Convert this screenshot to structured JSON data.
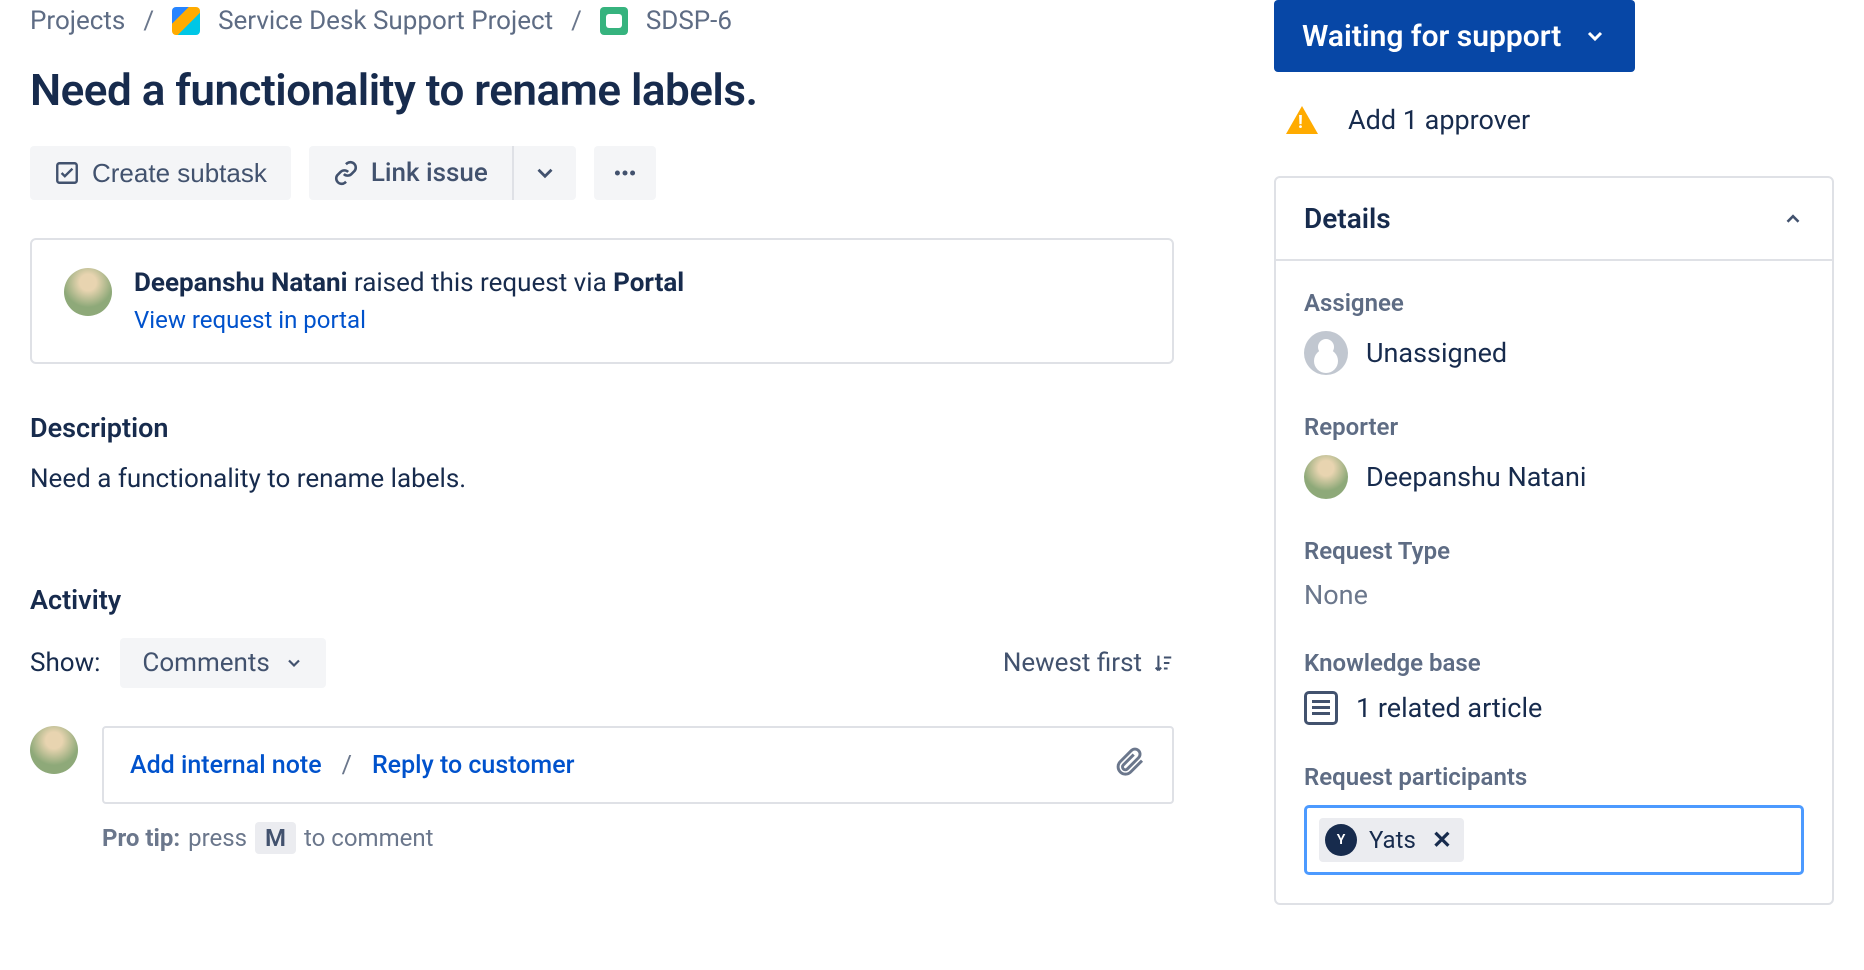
{
  "breadcrumb": {
    "root": "Projects",
    "project": "Service Desk Support Project",
    "issue": "SDSP-6"
  },
  "issue": {
    "title": "Need a functionality to rename labels."
  },
  "actions": {
    "create_subtask": "Create subtask",
    "link_issue": "Link issue"
  },
  "portal": {
    "reporter": "Deepanshu Natani",
    "raised_text": " raised this request via ",
    "channel": "Portal",
    "view_link": "View request in portal"
  },
  "description": {
    "heading": "Description",
    "body": "Need a functionality to rename labels."
  },
  "activity": {
    "heading": "Activity",
    "show_label": "Show:",
    "filter": "Comments",
    "sort": "Newest first",
    "add_internal": "Add internal note",
    "reply_customer": "Reply to customer",
    "pro_tip_label": "Pro tip:",
    "pro_tip_prefix": " press ",
    "pro_tip_key": "M",
    "pro_tip_suffix": " to comment"
  },
  "side": {
    "status": "Waiting for support",
    "approver": "Add 1 approver",
    "details_header": "Details",
    "assignee": {
      "label": "Assignee",
      "value": "Unassigned"
    },
    "reporter": {
      "label": "Reporter",
      "value": "Deepanshu Natani"
    },
    "request_type": {
      "label": "Request Type",
      "value": "None"
    },
    "knowledge_base": {
      "label": "Knowledge base",
      "value": "1 related article"
    },
    "participants": {
      "label": "Request participants",
      "chip_initial": "Y",
      "chip_text": "Yats"
    }
  }
}
